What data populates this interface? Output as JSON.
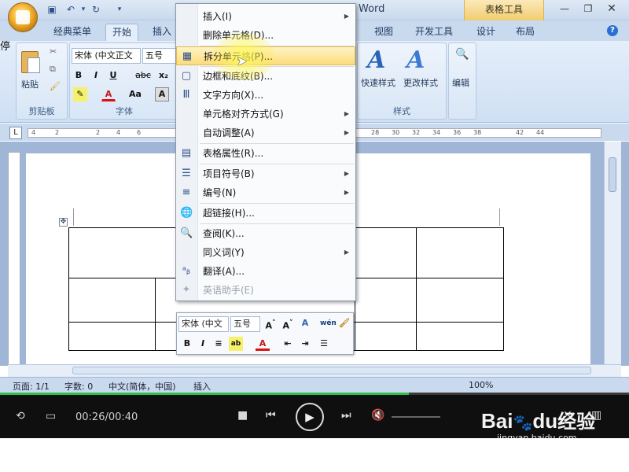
{
  "window": {
    "app_title": "Word",
    "table_tools": "表格工具",
    "left_cut_text": "暂停"
  },
  "tabs": [
    "经典菜单",
    "开始",
    "插入",
    "视图",
    "开发工具",
    "设计",
    "布局"
  ],
  "ribbon": {
    "clipboard": {
      "paste": "粘贴",
      "label": "剪贴板"
    },
    "font": {
      "font_name": "宋体 (中文正文",
      "font_size": "五号",
      "label": "字体"
    },
    "styles": {
      "quick_styles": "快速样式",
      "change_styles": "更改样式",
      "label": "样式"
    },
    "editing": {
      "label": "编辑"
    }
  },
  "ruler_ticks": [
    "4",
    "2",
    "2",
    "4",
    "6",
    "28",
    "30",
    "32",
    "34",
    "36",
    "38",
    "42",
    "44"
  ],
  "context_menu": {
    "items": [
      {
        "label": "插入(I)",
        "icon": "",
        "submenu": true,
        "disabled": false
      },
      {
        "label": "删除单元格(D)...",
        "icon": "",
        "submenu": false,
        "disabled": false
      },
      {
        "label": "拆分单元格(P)...",
        "icon": "split-cells-icon",
        "submenu": false,
        "disabled": false,
        "highlighted": true
      },
      {
        "label": "边框和底纹(B)...",
        "icon": "borders-icon",
        "submenu": false,
        "disabled": false
      },
      {
        "label": "文字方向(X)...",
        "icon": "text-direction-icon",
        "submenu": false,
        "disabled": false
      },
      {
        "label": "单元格对齐方式(G)",
        "icon": "",
        "submenu": true,
        "disabled": false
      },
      {
        "label": "自动调整(A)",
        "icon": "",
        "submenu": true,
        "disabled": false
      },
      {
        "label": "表格属性(R)...",
        "icon": "table-properties-icon",
        "submenu": false,
        "disabled": false
      },
      {
        "label": "项目符号(B)",
        "icon": "bullets-icon",
        "submenu": true,
        "disabled": false
      },
      {
        "label": "编号(N)",
        "icon": "numbering-icon",
        "submenu": true,
        "disabled": false
      },
      {
        "label": "超链接(H)...",
        "icon": "hyperlink-icon",
        "submenu": false,
        "disabled": false
      },
      {
        "label": "查阅(K)...",
        "icon": "research-icon",
        "submenu": false,
        "disabled": false
      },
      {
        "label": "同义词(Y)",
        "icon": "",
        "submenu": true,
        "disabled": false
      },
      {
        "label": "翻译(A)...",
        "icon": "translate-icon",
        "submenu": false,
        "disabled": false
      },
      {
        "label": "英语助手(E)",
        "icon": "english-assistant-icon",
        "submenu": false,
        "disabled": true
      }
    ]
  },
  "mini_toolbar": {
    "font_name": "宋体 (中文",
    "font_size": "五号"
  },
  "status_bar": {
    "page": "页面: 1/1",
    "words": "字数: 0",
    "language": "中文(简体，中国)",
    "mode": "插入",
    "zoom": "100%"
  },
  "player": {
    "time": "00:26/00:40",
    "progress": 0.65
  },
  "watermark": {
    "brand": "Bai",
    "brand2": "du",
    "cn": "经验",
    "url": "jingyan.baidu.com"
  }
}
